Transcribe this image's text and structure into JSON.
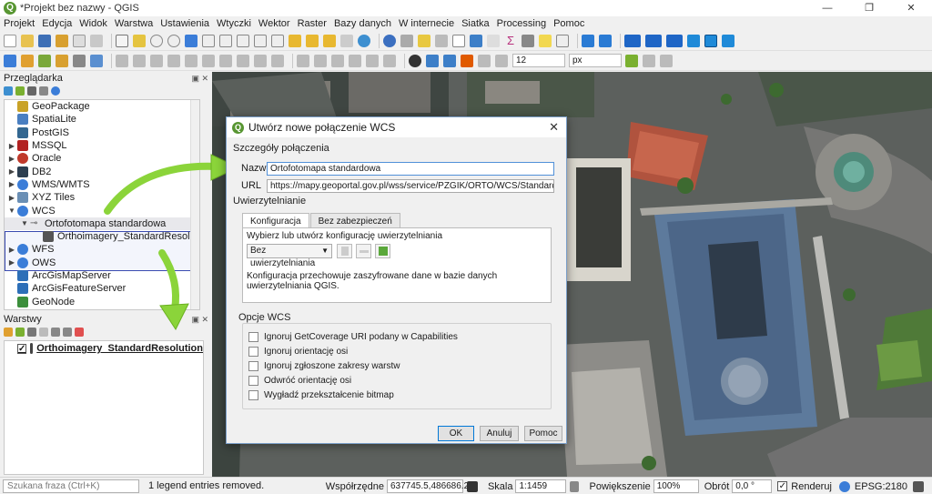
{
  "window": {
    "title": "*Projekt bez nazwy - QGIS",
    "logo_letter": "Q",
    "min": "—",
    "max": "❐",
    "close": "✕"
  },
  "menu": [
    "Projekt",
    "Edycja",
    "Widok",
    "Warstwa",
    "Ustawienia",
    "Wtyczki",
    "Wektor",
    "Raster",
    "Bazy danych",
    "W internecie",
    "Siatka",
    "Processing",
    "Pomoc"
  ],
  "toolbar2": {
    "size_value": "12",
    "unit_value": "px"
  },
  "browser": {
    "title": "Przeglądarka",
    "items": [
      {
        "label": "GeoPackage",
        "arrow": "",
        "icon_color": "#c9a227"
      },
      {
        "label": "SpatiaLite",
        "arrow": "",
        "icon_color": "#4a7fc1"
      },
      {
        "label": "PostGIS",
        "arrow": "",
        "icon_color": "#336791"
      },
      {
        "label": "MSSQL",
        "arrow": "▶",
        "icon_color": "#b22222"
      },
      {
        "label": "Oracle",
        "arrow": "▶",
        "icon_color": "#c0392b"
      },
      {
        "label": "DB2",
        "arrow": "▶",
        "icon_color": "#2c3e50"
      },
      {
        "label": "WMS/WMTS",
        "arrow": "▶",
        "icon_color": "#3b7dd8"
      },
      {
        "label": "XYZ Tiles",
        "arrow": "▶",
        "icon_color": "#6a8fb5"
      },
      {
        "label": "WCS",
        "arrow": "▼",
        "icon_color": "#3b7dd8"
      },
      {
        "label": "Ortofotomapa standardowa",
        "arrow": "▼",
        "icon_color": "#777777"
      },
      {
        "label": "Orthoimagery_StandardResolution",
        "arrow": "",
        "icon_color": "#555555"
      },
      {
        "label": "WFS",
        "arrow": "▶",
        "icon_color": "#3b7dd8"
      },
      {
        "label": "OWS",
        "arrow": "▶",
        "icon_color": "#3b7dd8"
      },
      {
        "label": "ArcGisMapServer",
        "arrow": "",
        "icon_color": "#2d6fb8"
      },
      {
        "label": "ArcGisFeatureServer",
        "arrow": "",
        "icon_color": "#2d6fb8"
      },
      {
        "label": "GeoNode",
        "arrow": "",
        "icon_color": "#3c8f3c"
      }
    ]
  },
  "layers": {
    "title": "Warstwy",
    "items": [
      {
        "label": "Orthoimagery_StandardResolution",
        "checked": "✓"
      }
    ]
  },
  "dialog": {
    "title": "Utwórz nowe połączenie WCS",
    "section_details": "Szczegóły połączenia",
    "name_label": "Nazwa",
    "name_value": "Ortofotomapa standardowa",
    "url_label": "URL",
    "url_value": "https://mapy.geoportal.gov.pl/wss/service/PZGIK/ORTO/WCS/StandardResolution",
    "auth_section": "Uwierzytelnianie",
    "tab_config": "Konfiguracja",
    "tab_basic": "Bez zabezpieczeń",
    "config_prompt": "Wybierz lub utwórz konfigurację uwierzytelniania",
    "combo_value": "Bez uwierzytelniania",
    "config_note": "Konfiguracja przechowuje zaszyfrowane dane w bazie danych uwierzytelniania QGIS.",
    "options_section": "Opcje WCS",
    "options": [
      "Ignoruj GetCoverage URI podany w Capabilities",
      "Ignoruj orientację osi",
      "Ignoruj zgłoszone zakresy warstw",
      "Odwróć orientację osi",
      "Wygładź przekształcenie bitmap"
    ],
    "ok": "OK",
    "cancel": "Anuluj",
    "help": "Pomoc"
  },
  "status": {
    "search_placeholder": "Szukana fraza (Ctrl+K)",
    "message": "1 legend entries removed.",
    "coord_label": "Współrzędne",
    "coord_value": "637745.5,486686.2",
    "scale_label": "Skala",
    "scale_value": "1:1459",
    "zoom_label": "Powiększenie",
    "zoom_value": "100%",
    "rotation_label": "Obrót",
    "rotation_value": "0,0 °",
    "render_label": "Renderuj",
    "crs": "EPSG:2180"
  },
  "colors": {
    "accent": "#3a4bb0",
    "arrow_green": "#8bd43a",
    "qgis_green": "#589632"
  }
}
